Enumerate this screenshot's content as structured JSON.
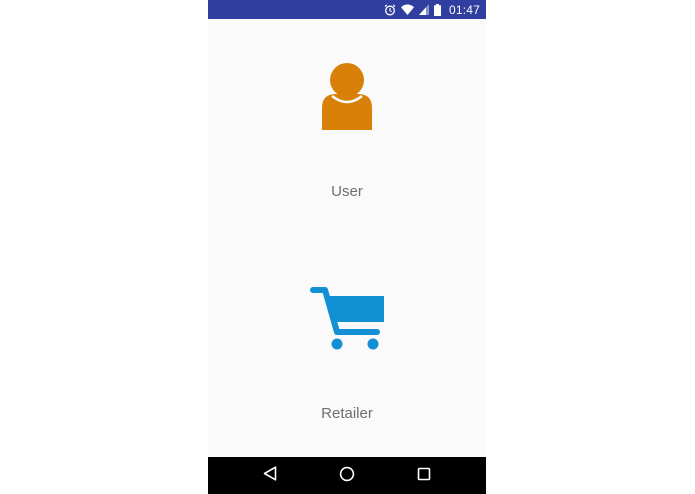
{
  "status_bar": {
    "time": "01:47",
    "icons": [
      "alarm-icon",
      "wifi-icon",
      "signal-icon",
      "battery-icon"
    ],
    "color": "#303f9f"
  },
  "options": [
    {
      "label": "User",
      "icon": "user-icon",
      "icon_color": "#d98009"
    },
    {
      "label": "Retailer",
      "icon": "shopping-cart-icon",
      "icon_color": "#1190d3"
    }
  ],
  "nav_bar": {
    "buttons": [
      "back-icon",
      "home-icon",
      "recents-icon"
    ],
    "color": "#000000"
  }
}
